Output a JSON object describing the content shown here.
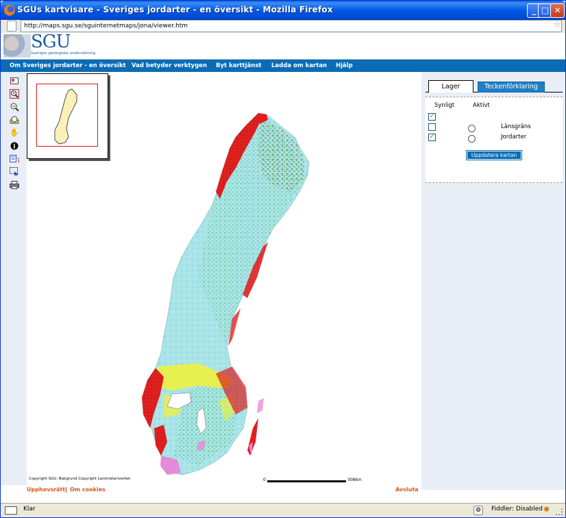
{
  "window": {
    "title": "SGUs kartvisare - Sveriges jordarter - en översikt - Mozilla Firefox",
    "minimize_icon": "minimize-icon",
    "maximize_icon": "maximize-icon",
    "close_icon": "close-icon"
  },
  "address": {
    "url": "http://maps.sgu.se/sguinternetmaps/jona/viewer.htm",
    "bookmark_icon": "star-icon"
  },
  "site": {
    "logo_text": "SGU",
    "logo_subtitle": "Sveriges geologiska undersökning"
  },
  "nav": {
    "items": [
      "Om Sveriges jordarter - en översikt",
      "Vad betyder verktygen",
      "Byt karttjänst",
      "Ladda om kartan",
      "Hjälp"
    ]
  },
  "toolbar": {
    "tools": [
      "full-extent-icon",
      "zoom-in-icon",
      "zoom-out-icon",
      "previous-extent-icon",
      "pan-icon",
      "identify-icon",
      "query-icon",
      "select-icon",
      "print-icon"
    ]
  },
  "map": {
    "copyright": "Copyright SGU. Bakgrund Copyright Lantmäteriverket",
    "scale_start": "0",
    "scale_end": "308km",
    "colors": {
      "till": "#a8e4e8",
      "clay": "#f2f236",
      "peat": "#9b8a66",
      "rock": "#e02020",
      "glaciofluvial": "#3fb04a",
      "other": "#e58ad8"
    }
  },
  "footer": {
    "link1": "Upphovsrätt",
    "separator": "|",
    "link2": "Om cookies",
    "logout": "Avsluta"
  },
  "panel": {
    "tab_layers": "Lager",
    "tab_legend": "Teckenförklaring",
    "col_visible": "Synligt",
    "col_active": "Aktivt",
    "layers": [
      {
        "name": "",
        "visible": true
      },
      {
        "name": "Länsgräns",
        "visible": false
      },
      {
        "name": "Jordarter",
        "visible": true
      }
    ],
    "update_button": "Uppdatera kartan"
  },
  "status": {
    "text": "Klar",
    "fiddler": "Fiddler: Disabled"
  }
}
